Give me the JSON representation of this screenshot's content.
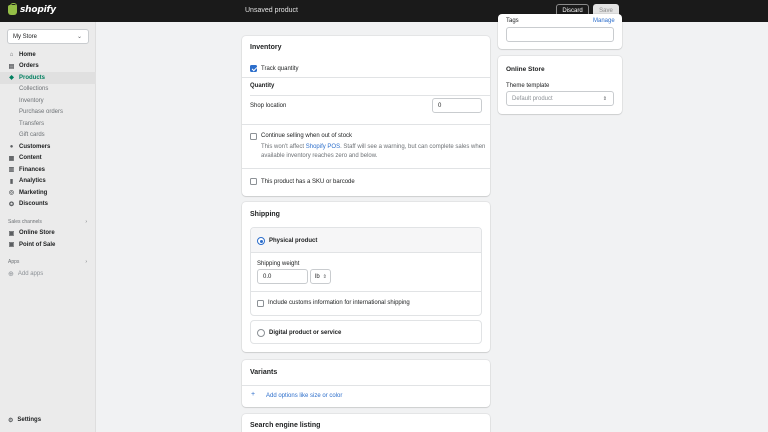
{
  "topbar": {
    "logo_text": "shopify",
    "title": "Unsaved product",
    "discard_label": "Discard",
    "save_label": "Save"
  },
  "sidebar": {
    "store": "My Store",
    "items": [
      {
        "label": "Home",
        "icon": "home-icon"
      },
      {
        "label": "Orders",
        "icon": "orders-icon"
      },
      {
        "label": "Products",
        "icon": "tag-icon",
        "active": true
      }
    ],
    "product_subitems": [
      "Collections",
      "Inventory",
      "Purchase orders",
      "Transfers",
      "Gift cards"
    ],
    "items2": [
      {
        "label": "Customers",
        "icon": "person-icon"
      },
      {
        "label": "Content",
        "icon": "content-icon"
      },
      {
        "label": "Finances",
        "icon": "bank-icon"
      },
      {
        "label": "Analytics",
        "icon": "chart-icon"
      },
      {
        "label": "Marketing",
        "icon": "target-icon"
      },
      {
        "label": "Discounts",
        "icon": "discount-icon"
      }
    ],
    "sales_channels_label": "Sales channels",
    "channels": [
      {
        "label": "Online Store",
        "icon": "store-icon"
      },
      {
        "label": "Point of Sale",
        "icon": "pos-icon"
      }
    ],
    "apps_label": "Apps",
    "add_apps": "Add apps",
    "settings": "Settings"
  },
  "inventory": {
    "title": "Inventory",
    "track_quantity": "Track quantity",
    "quantity_heading": "Quantity",
    "shop_location": "Shop location",
    "shop_location_value": "0",
    "continue_selling": "Continue selling when out of stock",
    "help_pre": "This won't affect ",
    "help_link": "Shopify POS",
    "help_post": ". Staff will see a warning, but can complete sales when",
    "help_line2": "available inventory reaches zero and below.",
    "sku": "This product has a SKU or barcode"
  },
  "shipping": {
    "title": "Shipping",
    "physical": "Physical product",
    "weight_label": "Shipping weight",
    "weight_value": "0.0",
    "weight_unit": "lb",
    "customs": "Include customs information for international shipping",
    "digital": "Digital product or service"
  },
  "variants": {
    "title": "Variants",
    "add_options": "Add options like size or color"
  },
  "seo": {
    "title": "Search engine listing"
  },
  "right": {
    "tags_label": "Tags",
    "manage_label": "Manage",
    "online_store_title": "Online Store",
    "theme_template_label": "Theme template",
    "theme_template_value": "Default product"
  }
}
